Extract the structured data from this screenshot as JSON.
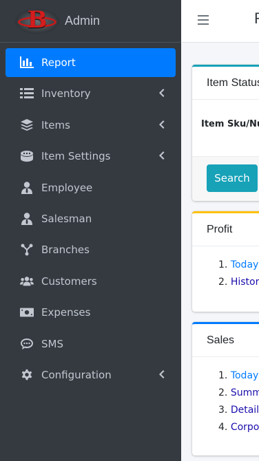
{
  "brand": {
    "letter": "B",
    "title": "Admin"
  },
  "sidebar": {
    "items": [
      {
        "label": "Report",
        "icon": "bar-chart-icon",
        "active": true,
        "has_submenu": false
      },
      {
        "label": "Inventory",
        "icon": "list-icon",
        "active": false,
        "has_submenu": true
      },
      {
        "label": "Items",
        "icon": "layers-icon",
        "active": false,
        "has_submenu": true
      },
      {
        "label": "Item Settings",
        "icon": "database-icon",
        "active": false,
        "has_submenu": true
      },
      {
        "label": "Employee",
        "icon": "user-tie-icon",
        "active": false,
        "has_submenu": false
      },
      {
        "label": "Salesman",
        "icon": "user-tie-icon",
        "active": false,
        "has_submenu": false
      },
      {
        "label": "Branches",
        "icon": "branches-icon",
        "active": false,
        "has_submenu": false
      },
      {
        "label": "Customers",
        "icon": "users-icon",
        "active": false,
        "has_submenu": false
      },
      {
        "label": "Expenses",
        "icon": "money-bill-icon",
        "active": false,
        "has_submenu": false
      },
      {
        "label": "SMS",
        "icon": "comment-dots-icon",
        "active": false,
        "has_submenu": false
      },
      {
        "label": "Configuration",
        "icon": "gear-icon",
        "active": false,
        "has_submenu": true
      }
    ]
  },
  "topbar": {
    "title": "R"
  },
  "item_status": {
    "header": "Item Status",
    "field_label": "Item Sku/Num",
    "search_label": "Search"
  },
  "profit": {
    "header": "Profit",
    "links": [
      {
        "num": "1.",
        "text": "Today"
      },
      {
        "num": "2.",
        "text": "History"
      }
    ]
  },
  "sales": {
    "header": "Sales",
    "links": [
      {
        "num": "1.",
        "text": "Today"
      },
      {
        "num": "2.",
        "text": "Summary"
      },
      {
        "num": "3.",
        "text": "Details"
      },
      {
        "num": "4.",
        "text": "Corporate"
      }
    ]
  },
  "colors": {
    "sidebar_bg": "#343a40",
    "active_bg": "#007bff",
    "info": "#17a2b8",
    "warning": "#ffc107",
    "primary": "#007bff"
  }
}
